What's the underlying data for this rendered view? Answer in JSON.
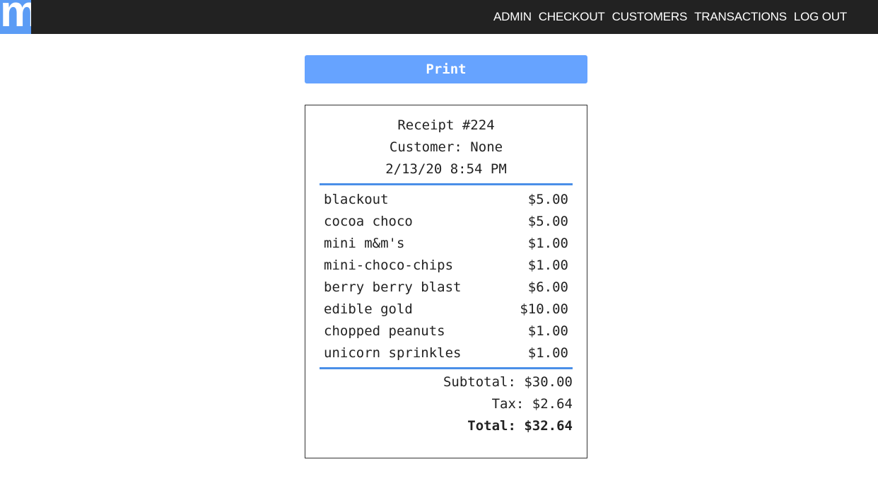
{
  "brand": {
    "logo_letter": "m",
    "logo_color": "#5b9cf5"
  },
  "nav": {
    "items": [
      {
        "label": "ADMIN"
      },
      {
        "label": "CHECKOUT"
      },
      {
        "label": "CUSTOMERS"
      },
      {
        "label": "TRANSACTIONS"
      },
      {
        "label": "LOG OUT"
      }
    ]
  },
  "print_button": {
    "label": "Print",
    "color": "#66a3ff"
  },
  "receipt": {
    "number_line": "Receipt #224",
    "customer_line": "Customer: None",
    "datetime": "2/13/20 8:54 PM",
    "divider_color": "#4a8fe8",
    "items": [
      {
        "name": "blackout",
        "price": "$5.00"
      },
      {
        "name": "cocoa choco",
        "price": "$5.00"
      },
      {
        "name": "mini m&m's",
        "price": "$1.00"
      },
      {
        "name": "mini-choco-chips",
        "price": "$1.00"
      },
      {
        "name": "berry berry blast",
        "price": "$6.00"
      },
      {
        "name": "edible gold",
        "price": "$10.00"
      },
      {
        "name": "chopped peanuts",
        "price": "$1.00"
      },
      {
        "name": "unicorn sprinkles",
        "price": "$1.00"
      }
    ],
    "subtotal_line": "Subtotal: $30.00",
    "tax_line": "Tax: $2.64",
    "total_line": "Total: $32.64"
  }
}
